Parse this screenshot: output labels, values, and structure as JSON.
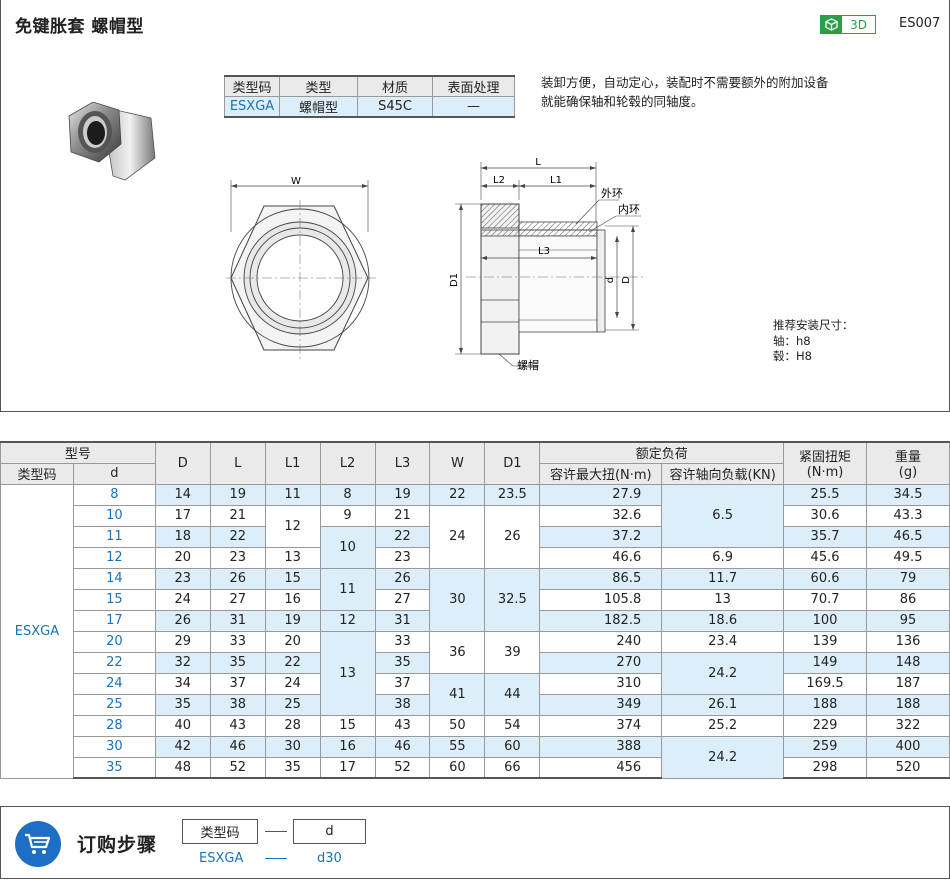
{
  "header": {
    "title": "免键胀套   螺帽型",
    "badge_3d": "3D",
    "code": "ES007"
  },
  "spec_table": {
    "headers": [
      "类型码",
      "类型",
      "材质",
      "表面处理"
    ],
    "row": [
      "ESXGA",
      "螺帽型",
      "S45C",
      "—"
    ]
  },
  "description": [
    "装卸方便，自动定心，装配时不需要额外的附加设备",
    "就能确保轴和轮毂的同轴度。"
  ],
  "install": {
    "title": "推荐安装尺寸：",
    "shaft": "轴：h8",
    "hub": "毂：H8"
  },
  "drawing_labels": {
    "W": "W",
    "L": "L",
    "L1": "L1",
    "L2": "L2",
    "L3": "L3",
    "D": "D",
    "D1": "D1",
    "d": "d",
    "outer": "外环",
    "inner": "内环",
    "nut": "螺帽"
  },
  "main_table": {
    "group_model": "型号",
    "type_code": "类型码",
    "d": "d",
    "D": "D",
    "L": "L",
    "L1": "L1",
    "L2": "L2",
    "L3": "L3",
    "W": "W",
    "D1": "D1",
    "rated_load": "额定负荷",
    "max_torque": "容许最大扭(N·m)",
    "axial_load": "容许轴向负载(KN)",
    "tightening": "紧固扭矩",
    "tightening_unit": "(N·m)",
    "weight": "重量",
    "weight_unit": "(g)",
    "type_value": "ESXGA",
    "rows": [
      {
        "d": "8",
        "D": "14",
        "L": "19",
        "L1": "11",
        "L2": "8",
        "L3": "19",
        "W": "22",
        "D1": "23.5",
        "torque": "27.9",
        "tight": "25.5",
        "weight": "34.5"
      },
      {
        "d": "10",
        "D": "17",
        "L": "21",
        "L2": "9",
        "L3": "21",
        "torque": "32.6",
        "tight": "30.6",
        "weight": "43.3"
      },
      {
        "d": "11",
        "D": "18",
        "L": "22",
        "L3": "22",
        "torque": "37.2",
        "tight": "35.7",
        "weight": "46.5"
      },
      {
        "d": "12",
        "D": "20",
        "L": "23",
        "L1": "13",
        "L3": "23",
        "torque": "46.6",
        "axial": "6.9",
        "tight": "45.6",
        "weight": "49.5"
      },
      {
        "d": "14",
        "D": "23",
        "L": "26",
        "L1": "15",
        "L3": "26",
        "torque": "86.5",
        "axial": "11.7",
        "tight": "60.6",
        "weight": "79"
      },
      {
        "d": "15",
        "D": "24",
        "L": "27",
        "L1": "16",
        "L3": "27",
        "torque": "105.8",
        "axial": "13",
        "tight": "70.7",
        "weight": "86"
      },
      {
        "d": "17",
        "D": "26",
        "L": "31",
        "L1": "19",
        "L2": "12",
        "L3": "31",
        "torque": "182.5",
        "axial": "18.6",
        "tight": "100",
        "weight": "95"
      },
      {
        "d": "20",
        "D": "29",
        "L": "33",
        "L1": "20",
        "L3": "33",
        "torque": "240",
        "axial": "23.4",
        "tight": "139",
        "weight": "136"
      },
      {
        "d": "22",
        "D": "32",
        "L": "35",
        "L1": "22",
        "L3": "35",
        "torque": "270",
        "tight": "149",
        "weight": "148"
      },
      {
        "d": "24",
        "D": "34",
        "L": "37",
        "L1": "24",
        "L3": "37",
        "torque": "310",
        "tight": "169.5",
        "weight": "187"
      },
      {
        "d": "25",
        "D": "35",
        "L": "38",
        "L1": "25",
        "L3": "38",
        "torque": "349",
        "axial": "26.1",
        "tight": "188",
        "weight": "188"
      },
      {
        "d": "28",
        "D": "40",
        "L": "43",
        "L1": "28",
        "L2": "15",
        "L3": "43",
        "W": "50",
        "D1": "54",
        "torque": "374",
        "axial": "25.2",
        "tight": "229",
        "weight": "322"
      },
      {
        "d": "30",
        "D": "42",
        "L": "46",
        "L1": "30",
        "L2": "16",
        "L3": "46",
        "W": "55",
        "D1": "60",
        "torque": "388",
        "tight": "259",
        "weight": "400"
      },
      {
        "d": "35",
        "D": "48",
        "L": "52",
        "L1": "35",
        "L2": "17",
        "L3": "52",
        "W": "60",
        "D1": "66",
        "torque": "456",
        "tight": "298",
        "weight": "520"
      }
    ],
    "merged": {
      "L1_rows_2_3": "12",
      "L2_rows_3_4": "10",
      "L2_rows_5_6": "11",
      "L2_rows_8_11": "13",
      "W_rows_2_4": "24",
      "D1_rows_2_4": "26",
      "W_rows_5_7": "30",
      "D1_rows_5_7": "32.5",
      "W_rows_8_9": "36",
      "D1_rows_8_9": "39",
      "W_rows_10_11": "41",
      "D1_rows_10_11": "44",
      "axial_rows_1_3": "6.5",
      "axial_rows_9_10": "24.2",
      "axial_rows_13_14": "24.2"
    }
  },
  "order": {
    "title": "订购步骤",
    "box1": "类型码",
    "box2": "d",
    "val1": "ESXGA",
    "val2": "d30"
  },
  "colors": {
    "accent_blue": "#1a73b8",
    "highlight": "#dceefa",
    "header_gray": "#eaeaea",
    "green_3d": "#2aa046",
    "cart_blue": "#1c6fc4"
  }
}
